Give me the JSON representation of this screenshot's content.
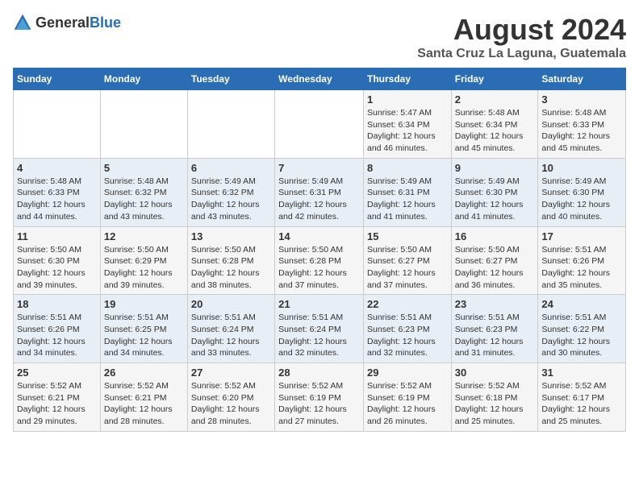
{
  "logo": {
    "text_general": "General",
    "text_blue": "Blue"
  },
  "title": {
    "month_year": "August 2024",
    "location": "Santa Cruz La Laguna, Guatemala"
  },
  "days_of_week": [
    "Sunday",
    "Monday",
    "Tuesday",
    "Wednesday",
    "Thursday",
    "Friday",
    "Saturday"
  ],
  "weeks": [
    [
      {
        "day": "",
        "info": ""
      },
      {
        "day": "",
        "info": ""
      },
      {
        "day": "",
        "info": ""
      },
      {
        "day": "",
        "info": ""
      },
      {
        "day": "1",
        "info": "Sunrise: 5:47 AM\nSunset: 6:34 PM\nDaylight: 12 hours and 46 minutes."
      },
      {
        "day": "2",
        "info": "Sunrise: 5:48 AM\nSunset: 6:34 PM\nDaylight: 12 hours and 45 minutes."
      },
      {
        "day": "3",
        "info": "Sunrise: 5:48 AM\nSunset: 6:33 PM\nDaylight: 12 hours and 45 minutes."
      }
    ],
    [
      {
        "day": "4",
        "info": "Sunrise: 5:48 AM\nSunset: 6:33 PM\nDaylight: 12 hours and 44 minutes."
      },
      {
        "day": "5",
        "info": "Sunrise: 5:48 AM\nSunset: 6:32 PM\nDaylight: 12 hours and 43 minutes."
      },
      {
        "day": "6",
        "info": "Sunrise: 5:49 AM\nSunset: 6:32 PM\nDaylight: 12 hours and 43 minutes."
      },
      {
        "day": "7",
        "info": "Sunrise: 5:49 AM\nSunset: 6:31 PM\nDaylight: 12 hours and 42 minutes."
      },
      {
        "day": "8",
        "info": "Sunrise: 5:49 AM\nSunset: 6:31 PM\nDaylight: 12 hours and 41 minutes."
      },
      {
        "day": "9",
        "info": "Sunrise: 5:49 AM\nSunset: 6:30 PM\nDaylight: 12 hours and 41 minutes."
      },
      {
        "day": "10",
        "info": "Sunrise: 5:49 AM\nSunset: 6:30 PM\nDaylight: 12 hours and 40 minutes."
      }
    ],
    [
      {
        "day": "11",
        "info": "Sunrise: 5:50 AM\nSunset: 6:30 PM\nDaylight: 12 hours and 39 minutes."
      },
      {
        "day": "12",
        "info": "Sunrise: 5:50 AM\nSunset: 6:29 PM\nDaylight: 12 hours and 39 minutes."
      },
      {
        "day": "13",
        "info": "Sunrise: 5:50 AM\nSunset: 6:28 PM\nDaylight: 12 hours and 38 minutes."
      },
      {
        "day": "14",
        "info": "Sunrise: 5:50 AM\nSunset: 6:28 PM\nDaylight: 12 hours and 37 minutes."
      },
      {
        "day": "15",
        "info": "Sunrise: 5:50 AM\nSunset: 6:27 PM\nDaylight: 12 hours and 37 minutes."
      },
      {
        "day": "16",
        "info": "Sunrise: 5:50 AM\nSunset: 6:27 PM\nDaylight: 12 hours and 36 minutes."
      },
      {
        "day": "17",
        "info": "Sunrise: 5:51 AM\nSunset: 6:26 PM\nDaylight: 12 hours and 35 minutes."
      }
    ],
    [
      {
        "day": "18",
        "info": "Sunrise: 5:51 AM\nSunset: 6:26 PM\nDaylight: 12 hours and 34 minutes."
      },
      {
        "day": "19",
        "info": "Sunrise: 5:51 AM\nSunset: 6:25 PM\nDaylight: 12 hours and 34 minutes."
      },
      {
        "day": "20",
        "info": "Sunrise: 5:51 AM\nSunset: 6:24 PM\nDaylight: 12 hours and 33 minutes."
      },
      {
        "day": "21",
        "info": "Sunrise: 5:51 AM\nSunset: 6:24 PM\nDaylight: 12 hours and 32 minutes."
      },
      {
        "day": "22",
        "info": "Sunrise: 5:51 AM\nSunset: 6:23 PM\nDaylight: 12 hours and 32 minutes."
      },
      {
        "day": "23",
        "info": "Sunrise: 5:51 AM\nSunset: 6:23 PM\nDaylight: 12 hours and 31 minutes."
      },
      {
        "day": "24",
        "info": "Sunrise: 5:51 AM\nSunset: 6:22 PM\nDaylight: 12 hours and 30 minutes."
      }
    ],
    [
      {
        "day": "25",
        "info": "Sunrise: 5:52 AM\nSunset: 6:21 PM\nDaylight: 12 hours and 29 minutes."
      },
      {
        "day": "26",
        "info": "Sunrise: 5:52 AM\nSunset: 6:21 PM\nDaylight: 12 hours and 28 minutes."
      },
      {
        "day": "27",
        "info": "Sunrise: 5:52 AM\nSunset: 6:20 PM\nDaylight: 12 hours and 28 minutes."
      },
      {
        "day": "28",
        "info": "Sunrise: 5:52 AM\nSunset: 6:19 PM\nDaylight: 12 hours and 27 minutes."
      },
      {
        "day": "29",
        "info": "Sunrise: 5:52 AM\nSunset: 6:19 PM\nDaylight: 12 hours and 26 minutes."
      },
      {
        "day": "30",
        "info": "Sunrise: 5:52 AM\nSunset: 6:18 PM\nDaylight: 12 hours and 25 minutes."
      },
      {
        "day": "31",
        "info": "Sunrise: 5:52 AM\nSunset: 6:17 PM\nDaylight: 12 hours and 25 minutes."
      }
    ]
  ]
}
